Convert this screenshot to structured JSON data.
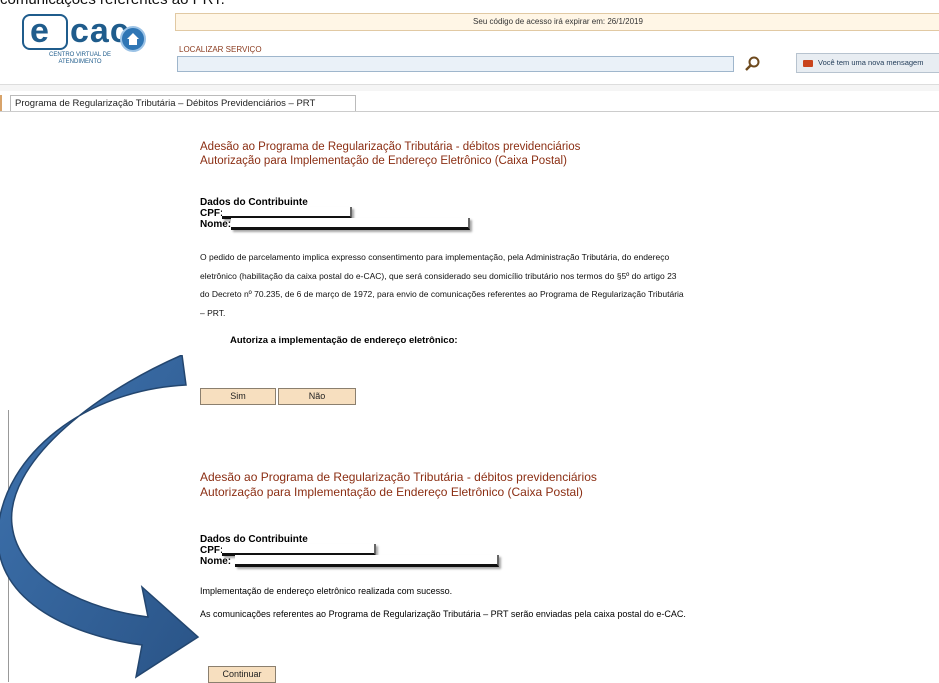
{
  "header": {
    "caption_fragment": "comunicações referentes ao PRT.",
    "logo": {
      "brand": "ecac",
      "subtitle": "CENTRO VIRTUAL DE ATENDIMENTO"
    },
    "expire_notice": "Seu código de acesso irá expirar em: 26/1/2019",
    "search_label": "LOCALIZAR SERVIÇO",
    "search_value": "",
    "message_button": "Você tem uma nova mensagem"
  },
  "tab": {
    "label": "Programa de Regularização Tributária – Débitos Previdenciários – PRT"
  },
  "panel1": {
    "title_line1": "Adesão ao Programa de Regularização Tributária - débitos previdenciários",
    "title_line2": "Autorização para Implementação de Endereço Eletrônico (Caixa Postal)",
    "section_title": "Dados do Contribuinte",
    "cpf_label": "CPF:",
    "nome_label": "Nome:",
    "paragraph_lines": [
      "O pedido de parcelamento implica expresso consentimento para implementação, pela Administração Tributária, do endereço",
      "eletrônico (habilitação da caixa postal do e-CAC), que será considerado seu domicílio tributário nos termos do §5º do artigo 23",
      "do Decreto nº 70.235, de 6 de março de 1972, para envio de comunicações referentes ao Programa de Regularização Tributária",
      "– PRT."
    ],
    "question": "Autoriza a implementação de endereço eletrônico:",
    "yes_button": "Sim",
    "no_button": "Não"
  },
  "panel2": {
    "title_line1": "Adesão ao Programa de Regularização Tributária - débitos previdenciários",
    "title_line2": "Autorização para Implementação de Endereço Eletrônico (Caixa Postal)",
    "section_title": "Dados do Contribuinte",
    "cpf_label": "CPF:",
    "nome_label": "Nome:",
    "success_line1": "Implementação de endereço eletrônico realizada com sucesso.",
    "success_line2": "As comunicações referentes ao Programa de Regularização Tributária – PRT serão enviadas pela caixa postal do e-CAC.",
    "continue_button": "Continuar"
  },
  "colors": {
    "brand_blue": "#1f5c8c",
    "title_brown": "#8b2e13",
    "button_fill": "#f7dfbf",
    "arrow_blue": "#2f5f95"
  },
  "icons": [
    "home-icon",
    "search-icon",
    "mail-icon",
    "curved-arrow-icon"
  ]
}
